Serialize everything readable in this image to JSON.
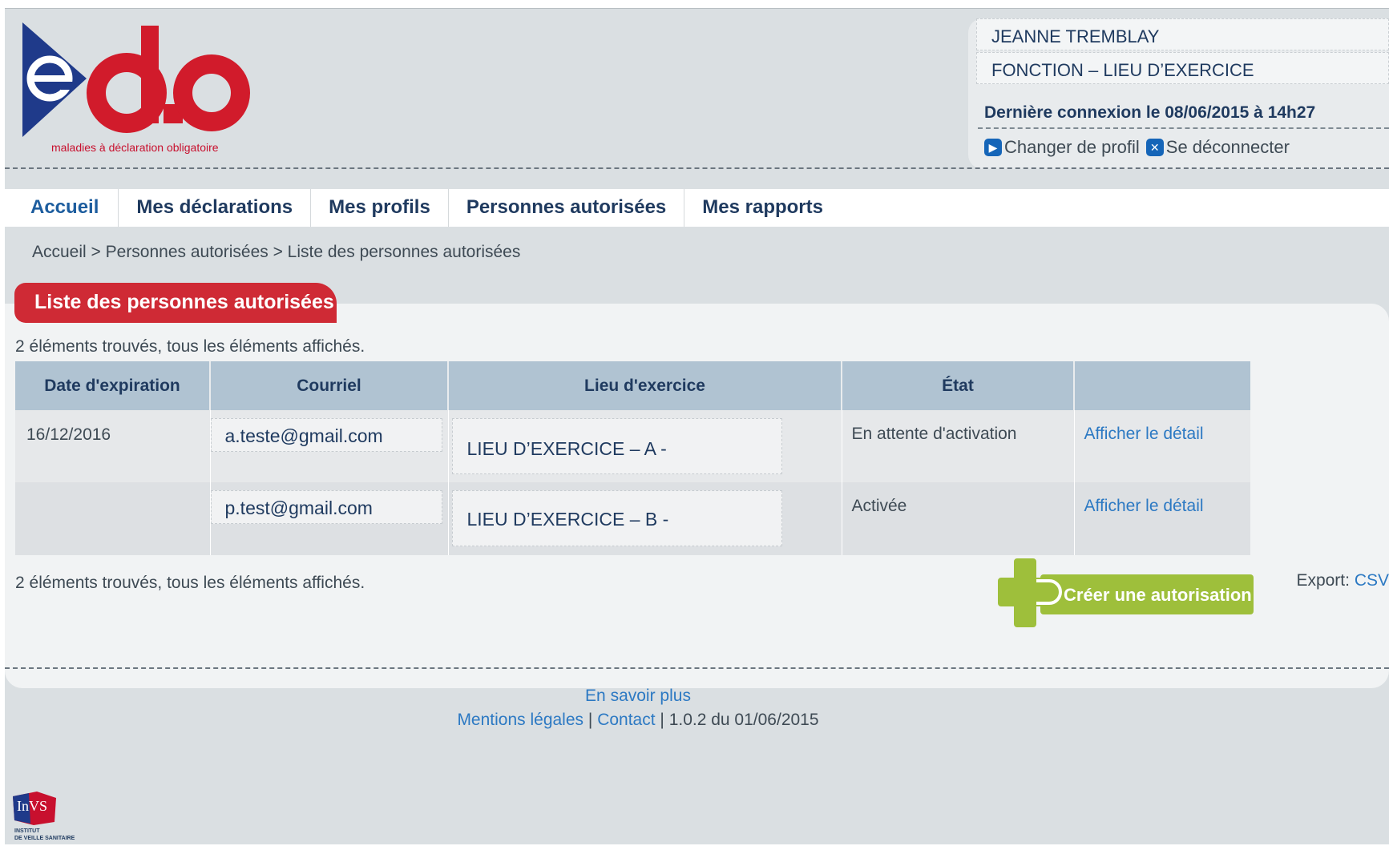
{
  "header": {
    "logo_tagline": "maladies à déclaration obligatoire",
    "logo_text": "e d.o",
    "user_name": "JEANNE TREMBLAY",
    "user_role": "FONCTION – LIEU D’EXERCICE",
    "last_login": "Dernière connexion le 08/06/2015 à 14h27",
    "change_profile": "Changer de profil",
    "logout": "Se déconnecter"
  },
  "nav": {
    "items": [
      "Accueil",
      "Mes déclarations",
      "Mes profils",
      "Personnes autorisées",
      "Mes rapports"
    ],
    "active": "Accueil"
  },
  "breadcrumb": "Accueil > Personnes autorisées > Liste des personnes autorisées",
  "panel": {
    "title": "Liste des personnes autorisées",
    "count_top": "2 éléments trouvés, tous les éléments affichés.",
    "count_bottom": "2 éléments trouvés, tous les éléments affichés."
  },
  "table": {
    "headers": [
      "Date d'expiration",
      "Courriel",
      "Lieu d'exercice",
      "État",
      ""
    ],
    "rows": [
      {
        "expiration": "16/12/2016",
        "email": "a.teste@gmail.com",
        "place": "LIEU D’EXERCICE – A -",
        "state": "En attente d'activation",
        "action": "Afficher le détail"
      },
      {
        "expiration": "",
        "email": "p.test@gmail.com",
        "place": "LIEU D’EXERCICE – B -",
        "state": "Activée",
        "action": "Afficher le détail"
      }
    ]
  },
  "export": {
    "label": "Export:",
    "format": "CSV"
  },
  "create_button": "Créer une autorisation",
  "footer": {
    "learn_more": "En savoir plus",
    "legal": "Mentions légales",
    "separator": "|",
    "contact": "Contact",
    "version": "| 1.0.2 du 01/06/2015"
  },
  "institute_logo": {
    "abbr": "InVS",
    "line1": "INSTITUT",
    "line2": "DE VEILLE SANITAIRE"
  },
  "colors": {
    "brand_red": "#cf2a35",
    "brand_blue": "#1f3a5f",
    "link_blue": "#2c79c3",
    "button_green": "#9ebf3b",
    "table_header": "#b0c3d2"
  }
}
